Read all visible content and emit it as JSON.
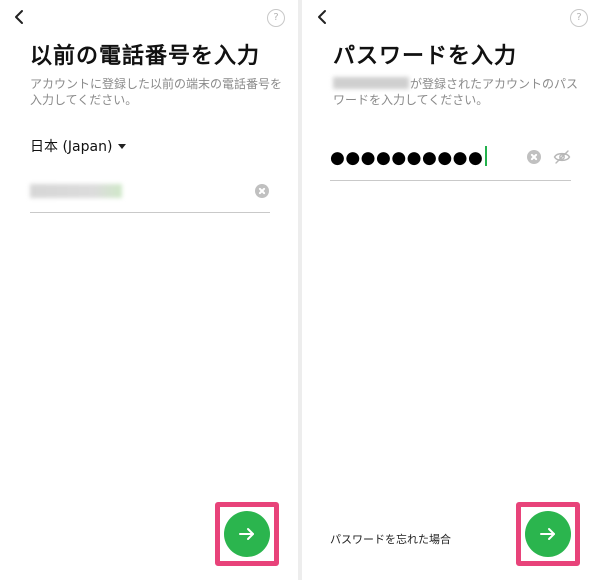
{
  "left": {
    "title": "以前の電話番号を入力",
    "description": "アカウントに登録した以前の端末の電話番号を入力してください。",
    "country_label": "日本 (Japan)",
    "help_label": "?"
  },
  "right": {
    "title": "パスワードを入力",
    "description_suffix": "が登録されたアカウントのパスワードを入力してください。",
    "password_mask": "●●●●●●●●●●",
    "forgot_label": "パスワードを忘れた場合",
    "help_label": "?"
  },
  "colors": {
    "accent_green": "#2bb54e",
    "highlight_pink": "#e8437a"
  },
  "icons": {
    "back": "chevron-left-icon",
    "help": "help-circle-icon",
    "clear": "clear-circle-icon",
    "visibility": "eye-off-icon",
    "next": "arrow-right-icon"
  }
}
